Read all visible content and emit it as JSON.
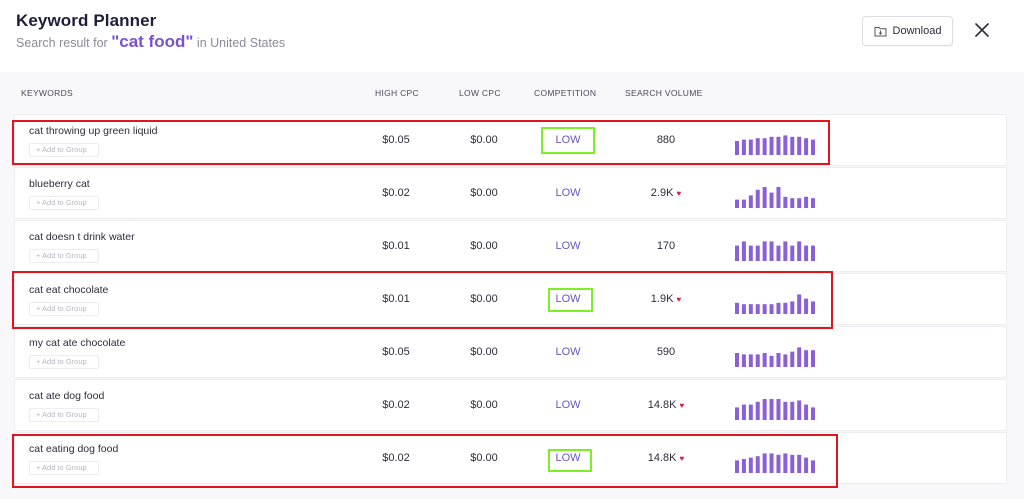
{
  "header": {
    "title": "Keyword Planner",
    "subtitle_prefix": "Search result for",
    "query": "\"cat food\"",
    "subtitle_suffix": "in United States",
    "download_label": "Download"
  },
  "columns": {
    "keywords": "KEYWORDS",
    "high_cpc": "HIGH CPC",
    "low_cpc": "LOW CPC",
    "competition": "COMPETITION",
    "search_volume": "SEARCH VOLUME"
  },
  "add_to_group_label": "+ Add to Group",
  "trend_color": "#8b5fd6",
  "highlight_color": "#e0161e",
  "competition_highlight_color": "#7cef27",
  "rows": [
    {
      "keyword": "cat throwing up green liquid",
      "high_cpc": "$0.05",
      "low_cpc": "$0.00",
      "competition": "LOW",
      "volume": "880",
      "trending_down": false,
      "highlighted": true,
      "trend": [
        0.5,
        0.55,
        0.55,
        0.6,
        0.6,
        0.65,
        0.65,
        0.7,
        0.65,
        0.65,
        0.6,
        0.55
      ]
    },
    {
      "keyword": "blueberry cat",
      "high_cpc": "$0.02",
      "low_cpc": "$0.00",
      "competition": "LOW",
      "volume": "2.9K",
      "trending_down": true,
      "highlighted": false,
      "trend": [
        0.3,
        0.3,
        0.45,
        0.65,
        0.75,
        0.55,
        0.75,
        0.4,
        0.35,
        0.35,
        0.4,
        0.35
      ]
    },
    {
      "keyword": "cat doesn t drink water",
      "high_cpc": "$0.01",
      "low_cpc": "$0.00",
      "competition": "LOW",
      "volume": "170",
      "trending_down": false,
      "highlighted": false,
      "trend": [
        0.55,
        0.7,
        0.55,
        0.55,
        0.7,
        0.7,
        0.55,
        0.7,
        0.55,
        0.7,
        0.55,
        0.55
      ]
    },
    {
      "keyword": "cat eat chocolate",
      "high_cpc": "$0.01",
      "low_cpc": "$0.00",
      "competition": "LOW",
      "volume": "1.9K",
      "trending_down": true,
      "highlighted": true,
      "trend": [
        0.4,
        0.35,
        0.35,
        0.35,
        0.35,
        0.35,
        0.4,
        0.4,
        0.45,
        0.7,
        0.55,
        0.45
      ]
    },
    {
      "keyword": "my cat ate chocolate",
      "high_cpc": "$0.05",
      "low_cpc": "$0.00",
      "competition": "LOW",
      "volume": "590",
      "trending_down": false,
      "highlighted": false,
      "trend": [
        0.5,
        0.45,
        0.45,
        0.45,
        0.5,
        0.4,
        0.5,
        0.45,
        0.55,
        0.7,
        0.6,
        0.6
      ]
    },
    {
      "keyword": "cat ate dog food",
      "high_cpc": "$0.02",
      "low_cpc": "$0.00",
      "competition": "LOW",
      "volume": "14.8K",
      "trending_down": true,
      "highlighted": false,
      "trend": [
        0.45,
        0.55,
        0.55,
        0.65,
        0.75,
        0.75,
        0.75,
        0.65,
        0.65,
        0.7,
        0.55,
        0.45
      ]
    },
    {
      "keyword": "cat eating dog food",
      "high_cpc": "$0.02",
      "low_cpc": "$0.00",
      "competition": "LOW",
      "volume": "14.8K",
      "trending_down": true,
      "highlighted": true,
      "trend": [
        0.45,
        0.5,
        0.55,
        0.6,
        0.7,
        0.7,
        0.65,
        0.7,
        0.65,
        0.65,
        0.55,
        0.45
      ]
    }
  ]
}
